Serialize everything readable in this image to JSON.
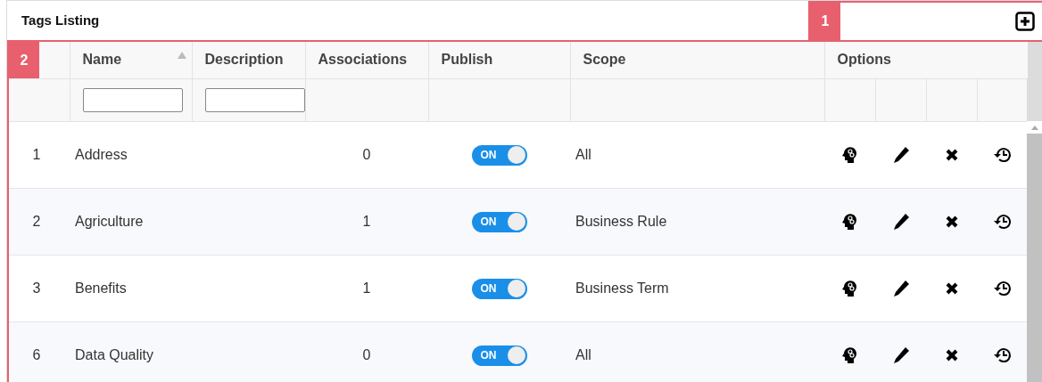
{
  "panel": {
    "title": "Tags Listing",
    "callouts": [
      "1",
      "2"
    ]
  },
  "table": {
    "columns": [
      {
        "label": "Name",
        "sorted": true
      },
      {
        "label": "Description",
        "sorted": false
      },
      {
        "label": "Associations",
        "sorted": false
      },
      {
        "label": "Publish",
        "sorted": false
      },
      {
        "label": "Scope",
        "sorted": false
      },
      {
        "label": "Options",
        "sorted": false
      }
    ],
    "rows": [
      {
        "number": "1",
        "name": "Address",
        "associations": "0",
        "publish": {
          "on": true,
          "label": "ON"
        },
        "scope": "All"
      },
      {
        "number": "2",
        "name": "Agriculture",
        "associations": "1",
        "publish": {
          "on": true,
          "label": "ON"
        },
        "scope": "Business Rule"
      },
      {
        "number": "3",
        "name": "Benefits",
        "associations": "1",
        "publish": {
          "on": true,
          "label": "ON"
        },
        "scope": "Business Term"
      },
      {
        "number": "6",
        "name": "Data Quality",
        "associations": "0",
        "publish": {
          "on": true,
          "label": "ON"
        },
        "scope": "All"
      }
    ]
  }
}
